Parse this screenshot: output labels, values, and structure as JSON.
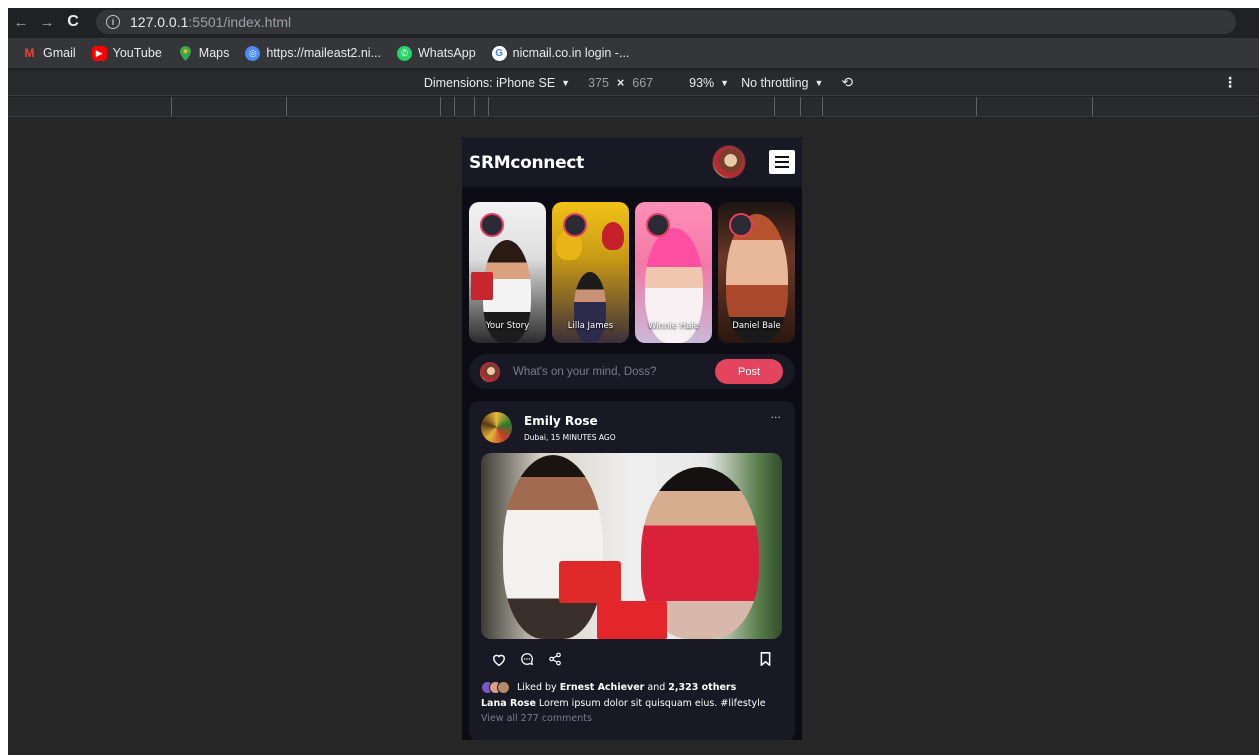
{
  "browser": {
    "url_host": "127.0.0.1",
    "url_path": ":5501/index.html",
    "bookmarks": [
      {
        "label": "Gmail",
        "icon": "gmail-icon",
        "color": "#ea4335"
      },
      {
        "label": "YouTube",
        "icon": "youtube-icon",
        "color": "#ff0000"
      },
      {
        "label": "Maps",
        "icon": "maps-icon",
        "color": "#34a853"
      },
      {
        "label": "https://maileast2.ni...",
        "icon": "globe-icon",
        "color": "#4c8bf5"
      },
      {
        "label": "WhatsApp",
        "icon": "whatsapp-icon",
        "color": "#25d366"
      },
      {
        "label": "nicmail.co.in login -...",
        "icon": "google-icon",
        "color": "#ffffff"
      }
    ]
  },
  "devtools": {
    "dimensions_label": "Dimensions: iPhone SE",
    "width": "375",
    "height": "667",
    "times": "×",
    "zoom": "93%",
    "throttling": "No throttling"
  },
  "app": {
    "logo": "SRMconnect",
    "stories": [
      {
        "name": "Your Story"
      },
      {
        "name": "Lilla James"
      },
      {
        "name": "Winnie Hale"
      },
      {
        "name": "Daniel Bale"
      }
    ],
    "create_post": {
      "placeholder": "What's on your mind, Doss?",
      "button": "Post"
    },
    "feed": {
      "author": "Emily Rose",
      "meta": "Dubai, 15 MINUTES AGO",
      "more": "···",
      "liked_prefix": "Liked by",
      "liked_by": "Ernest Achiever",
      "liked_and": "and",
      "liked_others": "2,323 others",
      "caption_user": "Lana Rose",
      "caption_text": "Lorem ipsum dolor sit quisquam eius. #lifestyle",
      "comments_link": "View all 277 comments"
    },
    "colors": {
      "accent": "#e4445e",
      "background": "#0d0c15",
      "card": "#191825",
      "muted": "#7d7a8c"
    }
  }
}
